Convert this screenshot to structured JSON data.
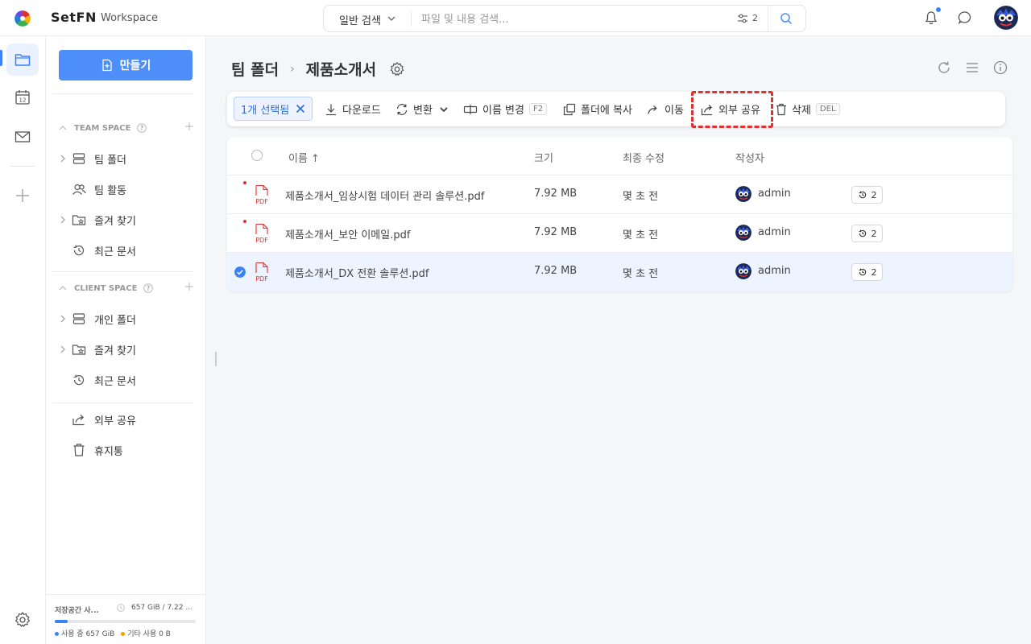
{
  "app": {
    "brand": "SetFN",
    "workspace": "Workspace"
  },
  "search": {
    "scope": "일반 검색",
    "placeholder": "파일 및 내용 검색...",
    "filter_count": "2"
  },
  "sidebar": {
    "create_label": "만들기",
    "team_space": {
      "title": "TEAM SPACE",
      "items": [
        {
          "label": "팀 폴더",
          "icon": "server-icon"
        },
        {
          "label": "팀 활동",
          "icon": "users-icon"
        },
        {
          "label": "즐겨 찾기",
          "icon": "star-folder-icon"
        },
        {
          "label": "최근 문서",
          "icon": "history-icon"
        }
      ]
    },
    "client_space": {
      "title": "CLIENT SPACE",
      "items": [
        {
          "label": "개인 폴더",
          "icon": "server-icon"
        },
        {
          "label": "즐겨 찾기",
          "icon": "star-folder-icon"
        },
        {
          "label": "최근 문서",
          "icon": "history-icon"
        }
      ]
    },
    "extra": [
      {
        "label": "외부 공유",
        "icon": "share-icon"
      },
      {
        "label": "휴지통",
        "icon": "trash-icon"
      }
    ],
    "storage": {
      "title": "저장공간 사...",
      "info": "657 GiB / 7.22 ...",
      "used_fraction": 0.09,
      "legend_used": "사용 중 657 GiB",
      "legend_other": "기타 사용 0 B",
      "color_used": "#3b82f6",
      "color_other": "#f59f00"
    }
  },
  "breadcrumb": {
    "root": "팀 폴더",
    "current": "제품소개서"
  },
  "toolbar": {
    "selected": "1개 선택됨",
    "download": "다운로드",
    "convert": "변환",
    "rename": "이름 변경",
    "rename_key": "F2",
    "copy": "폴더에 복사",
    "move": "이동",
    "share": "외부 공유",
    "delete": "삭제",
    "delete_key": "DEL"
  },
  "table": {
    "headers": {
      "name": "이름 ↑",
      "size": "크기",
      "modified": "최종 수정",
      "author": "작성자"
    },
    "rows": [
      {
        "name": "제품소개서_임상시험 데이터 관리 솔루션.pdf",
        "size": "7.92 MB",
        "modified": "몇 초 전",
        "author": "admin",
        "versions": "2",
        "file_type": "PDF",
        "selected": false,
        "is_new": true
      },
      {
        "name": "제품소개서_보안 이메일.pdf",
        "size": "7.92 MB",
        "modified": "몇 초 전",
        "author": "admin",
        "versions": "2",
        "file_type": "PDF",
        "selected": false,
        "is_new": true
      },
      {
        "name": "제품소개서_DX 전환 솔루션.pdf",
        "size": "7.92 MB",
        "modified": "몇 초 전",
        "author": "admin",
        "versions": "2",
        "file_type": "PDF",
        "selected": true,
        "is_new": false
      }
    ]
  },
  "colors": {
    "accent": "#4d8ef8",
    "highlight": "#e03131",
    "pdf": "#e03131"
  }
}
